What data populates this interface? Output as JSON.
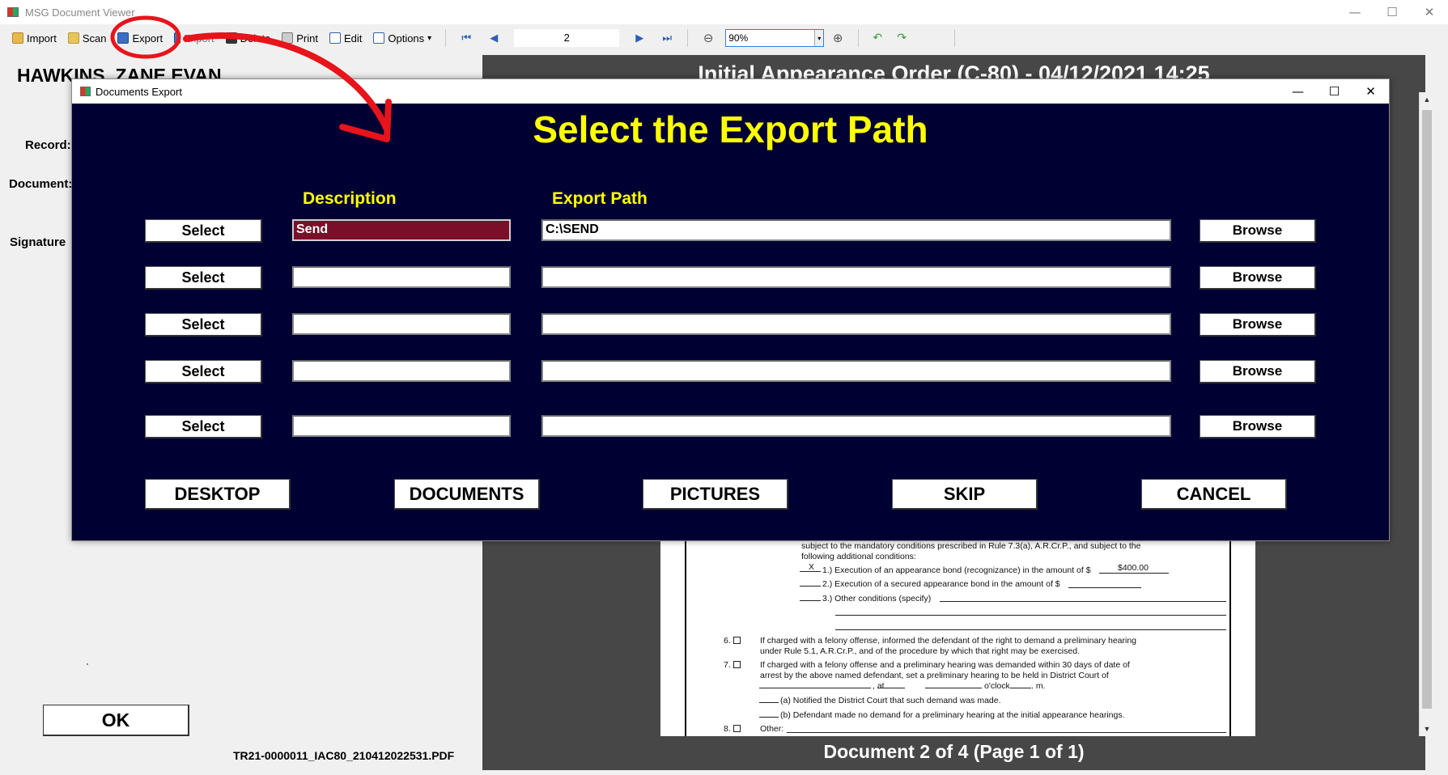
{
  "window": {
    "title": "MSG Document Viewer",
    "controls": {
      "minimize": "—",
      "maximize": "☐",
      "close": "✕"
    }
  },
  "toolbar": {
    "import": "Import",
    "scan": "Scan",
    "export": "Export",
    "export2": "Export",
    "delete": "Delete",
    "print": "Print",
    "edit": "Edit",
    "options": "Options",
    "options_caret": "▾",
    "page_number": "2",
    "zoom": "90%",
    "zoom_caret": "▾"
  },
  "left_panel": {
    "patient_name": "HAWKINS, ZANE EVAN",
    "record_label": "Record:",
    "document_label": "Document:",
    "signature_label": "Signature",
    "ok": "OK",
    "filename": "TR21-0000011_IAC80_210412022531.PDF"
  },
  "viewer": {
    "doc_title": "Initial Appearance Order (C-80) - 04/12/2021 14:25",
    "footer": "Document 2 of 4 (Page 1 of 1)",
    "lines": {
      "l1": "subject to the mandatory conditions prescribed in Rule 7.3(a), A.R.Cr.P., and subject to the",
      "l2": "following additional conditions:",
      "l3_mark": "X",
      "l3": "1.)  Execution of an appearance bond (recognizance) in the amount of $",
      "l3_amount": "$400.00",
      "l4": "2.)  Execution of a secured appearance bond in the amount of $",
      "l5": "3.)  Other conditions (specify)",
      "n6": "6.",
      "l6a": "If charged with a felony offense, informed the defendant of the right to demand a preliminary hearing",
      "l6b": "under Rule 5.1, A.R.Cr.P., and of the procedure by which that right may be exercised.",
      "n7": "7.",
      "l7a": "If charged with a felony offense and a preliminary hearing was demanded within 30 days of date of",
      "l7b": "arrest by the above named defendant, set a preliminary hearing to be held in District Court of",
      "l7c_at": ", at",
      "l7c_oclock": "o'clock",
      "l7c_m": ". m.",
      "l7d": "(a)     Notified the District Court that such demand was made.",
      "l7e": "(b)     Defendant made no demand for a preliminary hearing at the initial appearance hearings.",
      "n8": "8.",
      "l8": "Other:"
    }
  },
  "dialog": {
    "title": "Documents Export",
    "controls": {
      "minimize": "—",
      "maximize": "☐",
      "close": "✕"
    },
    "heading": "Select the Export Path",
    "col_description": "Description",
    "col_export_path": "Export Path",
    "select_label": "Select",
    "browse_label": "Browse",
    "rows": [
      {
        "description": "Send",
        "path": "C:\\SEND"
      },
      {
        "description": "",
        "path": ""
      },
      {
        "description": "",
        "path": ""
      },
      {
        "description": "",
        "path": ""
      },
      {
        "description": "",
        "path": ""
      }
    ],
    "buttons": {
      "desktop": "DESKTOP",
      "documents": "DOCUMENTS",
      "pictures": "PICTURES",
      "skip": "SKIP",
      "cancel": "CANCEL"
    }
  },
  "colors": {
    "dialog_bg": "#000033",
    "heading": "#ffff00",
    "active_field": "#7a0f2a",
    "annotation": "#e8141b"
  }
}
